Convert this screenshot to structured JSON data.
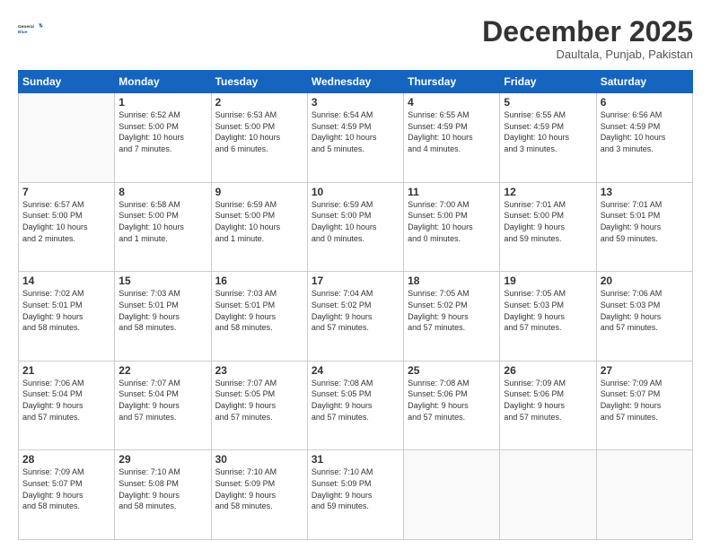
{
  "header": {
    "logo_general": "General",
    "logo_blue": "Blue",
    "month_title": "December 2025",
    "location": "Daultala, Punjab, Pakistan"
  },
  "days_of_week": [
    "Sunday",
    "Monday",
    "Tuesday",
    "Wednesday",
    "Thursday",
    "Friday",
    "Saturday"
  ],
  "weeks": [
    [
      {
        "day": "",
        "info": ""
      },
      {
        "day": "1",
        "info": "Sunrise: 6:52 AM\nSunset: 5:00 PM\nDaylight: 10 hours\nand 7 minutes."
      },
      {
        "day": "2",
        "info": "Sunrise: 6:53 AM\nSunset: 5:00 PM\nDaylight: 10 hours\nand 6 minutes."
      },
      {
        "day": "3",
        "info": "Sunrise: 6:54 AM\nSunset: 4:59 PM\nDaylight: 10 hours\nand 5 minutes."
      },
      {
        "day": "4",
        "info": "Sunrise: 6:55 AM\nSunset: 4:59 PM\nDaylight: 10 hours\nand 4 minutes."
      },
      {
        "day": "5",
        "info": "Sunrise: 6:55 AM\nSunset: 4:59 PM\nDaylight: 10 hours\nand 3 minutes."
      },
      {
        "day": "6",
        "info": "Sunrise: 6:56 AM\nSunset: 4:59 PM\nDaylight: 10 hours\nand 3 minutes."
      }
    ],
    [
      {
        "day": "7",
        "info": "Sunrise: 6:57 AM\nSunset: 5:00 PM\nDaylight: 10 hours\nand 2 minutes."
      },
      {
        "day": "8",
        "info": "Sunrise: 6:58 AM\nSunset: 5:00 PM\nDaylight: 10 hours\nand 1 minute."
      },
      {
        "day": "9",
        "info": "Sunrise: 6:59 AM\nSunset: 5:00 PM\nDaylight: 10 hours\nand 1 minute."
      },
      {
        "day": "10",
        "info": "Sunrise: 6:59 AM\nSunset: 5:00 PM\nDaylight: 10 hours\nand 0 minutes."
      },
      {
        "day": "11",
        "info": "Sunrise: 7:00 AM\nSunset: 5:00 PM\nDaylight: 10 hours\nand 0 minutes."
      },
      {
        "day": "12",
        "info": "Sunrise: 7:01 AM\nSunset: 5:00 PM\nDaylight: 9 hours\nand 59 minutes."
      },
      {
        "day": "13",
        "info": "Sunrise: 7:01 AM\nSunset: 5:01 PM\nDaylight: 9 hours\nand 59 minutes."
      }
    ],
    [
      {
        "day": "14",
        "info": "Sunrise: 7:02 AM\nSunset: 5:01 PM\nDaylight: 9 hours\nand 58 minutes."
      },
      {
        "day": "15",
        "info": "Sunrise: 7:03 AM\nSunset: 5:01 PM\nDaylight: 9 hours\nand 58 minutes."
      },
      {
        "day": "16",
        "info": "Sunrise: 7:03 AM\nSunset: 5:01 PM\nDaylight: 9 hours\nand 58 minutes."
      },
      {
        "day": "17",
        "info": "Sunrise: 7:04 AM\nSunset: 5:02 PM\nDaylight: 9 hours\nand 57 minutes."
      },
      {
        "day": "18",
        "info": "Sunrise: 7:05 AM\nSunset: 5:02 PM\nDaylight: 9 hours\nand 57 minutes."
      },
      {
        "day": "19",
        "info": "Sunrise: 7:05 AM\nSunset: 5:03 PM\nDaylight: 9 hours\nand 57 minutes."
      },
      {
        "day": "20",
        "info": "Sunrise: 7:06 AM\nSunset: 5:03 PM\nDaylight: 9 hours\nand 57 minutes."
      }
    ],
    [
      {
        "day": "21",
        "info": "Sunrise: 7:06 AM\nSunset: 5:04 PM\nDaylight: 9 hours\nand 57 minutes."
      },
      {
        "day": "22",
        "info": "Sunrise: 7:07 AM\nSunset: 5:04 PM\nDaylight: 9 hours\nand 57 minutes."
      },
      {
        "day": "23",
        "info": "Sunrise: 7:07 AM\nSunset: 5:05 PM\nDaylight: 9 hours\nand 57 minutes."
      },
      {
        "day": "24",
        "info": "Sunrise: 7:08 AM\nSunset: 5:05 PM\nDaylight: 9 hours\nand 57 minutes."
      },
      {
        "day": "25",
        "info": "Sunrise: 7:08 AM\nSunset: 5:06 PM\nDaylight: 9 hours\nand 57 minutes."
      },
      {
        "day": "26",
        "info": "Sunrise: 7:09 AM\nSunset: 5:06 PM\nDaylight: 9 hours\nand 57 minutes."
      },
      {
        "day": "27",
        "info": "Sunrise: 7:09 AM\nSunset: 5:07 PM\nDaylight: 9 hours\nand 57 minutes."
      }
    ],
    [
      {
        "day": "28",
        "info": "Sunrise: 7:09 AM\nSunset: 5:07 PM\nDaylight: 9 hours\nand 58 minutes."
      },
      {
        "day": "29",
        "info": "Sunrise: 7:10 AM\nSunset: 5:08 PM\nDaylight: 9 hours\nand 58 minutes."
      },
      {
        "day": "30",
        "info": "Sunrise: 7:10 AM\nSunset: 5:09 PM\nDaylight: 9 hours\nand 58 minutes."
      },
      {
        "day": "31",
        "info": "Sunrise: 7:10 AM\nSunset: 5:09 PM\nDaylight: 9 hours\nand 59 minutes."
      },
      {
        "day": "",
        "info": ""
      },
      {
        "day": "",
        "info": ""
      },
      {
        "day": "",
        "info": ""
      }
    ]
  ]
}
